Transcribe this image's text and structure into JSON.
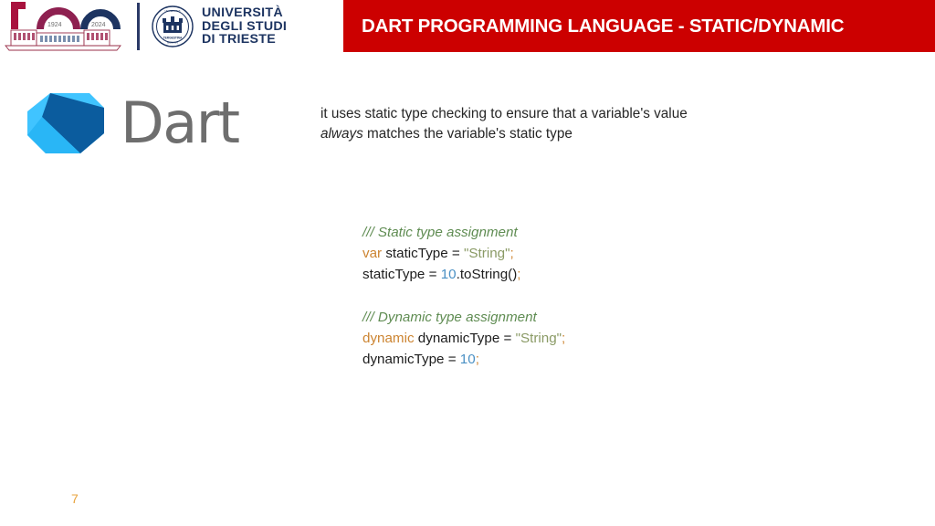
{
  "header": {
    "title": "DART PROGRAMMING LANGUAGE - STATIC/DYNAMIC",
    "title_bg": "#cc0000",
    "title_color": "#ffffff",
    "anniversary_logo": {
      "numeral": "100",
      "year_start": "1924",
      "year_end": "2024"
    },
    "university": {
      "line1": "UNIVERSITÀ",
      "line2": "DEGLI STUDI",
      "line3": "DI TRIESTE",
      "seal_motto_top": "UNIVERSITAS · STUDIORUM",
      "seal_motto_bottom": "MCMXXIV",
      "seal_label": "TERGESTINA",
      "color": "#1d3461"
    }
  },
  "logo": {
    "name": "dart-logo",
    "wordmark": "Dart",
    "color_light": "#40c4ff",
    "color_mid": "#29b6f6",
    "color_dark": "#0b5c9e",
    "wordmark_color": "#6e6e6e"
  },
  "body": {
    "text_before": "it uses static type checking to ensure that a variable's value ",
    "emphasis": "always",
    "text_after": " matches the variable's static type"
  },
  "code": {
    "lines": [
      [
        {
          "t": "/// Static type assignment",
          "c": "comment"
        }
      ],
      [
        {
          "t": "var",
          "c": "keyword"
        },
        {
          "t": " staticType = ",
          "c": "plain"
        },
        {
          "t": "\"String\"",
          "c": "string"
        },
        {
          "t": ";",
          "c": "punct"
        }
      ],
      [
        {
          "t": "staticType = ",
          "c": "plain"
        },
        {
          "t": "10",
          "c": "number"
        },
        {
          "t": ".toString()",
          "c": "plain"
        },
        {
          "t": ";",
          "c": "punct"
        }
      ],
      [],
      [
        {
          "t": "/// Dynamic type assignment",
          "c": "comment"
        }
      ],
      [
        {
          "t": "dynamic",
          "c": "keyword"
        },
        {
          "t": " dynamicType = ",
          "c": "plain"
        },
        {
          "t": "\"String\"",
          "c": "string"
        },
        {
          "t": ";",
          "c": "punct"
        }
      ],
      [
        {
          "t": "dynamicType = ",
          "c": "plain"
        },
        {
          "t": "10",
          "c": "number"
        },
        {
          "t": ";",
          "c": "punct"
        }
      ]
    ],
    "colors": {
      "comment": "#5f8c52",
      "keyword": "#cc8431",
      "string": "#8a9a65",
      "number": "#4a90c4",
      "punct": "#d08a3a",
      "plain": "#1d1d1d"
    }
  },
  "footer": {
    "page_number": "7",
    "page_number_color": "#e8a33d"
  }
}
